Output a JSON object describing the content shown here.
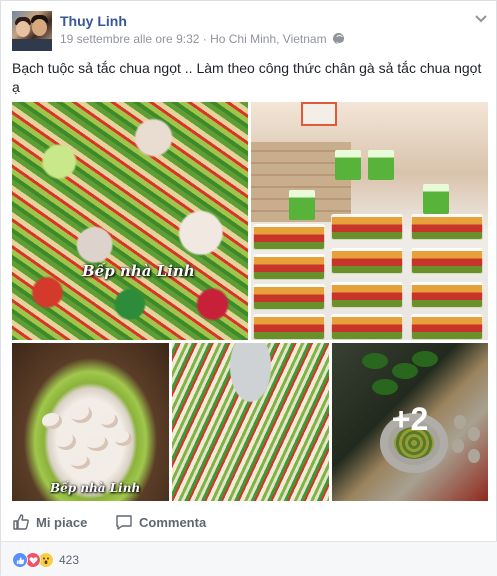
{
  "post": {
    "author": "Thuy Linh",
    "timestamp": "19 settembre alle ore 9:32",
    "location_sep": " · ",
    "location": "Ho Chi Minh, Vietnam",
    "privacy_icon": "globe-icon",
    "message": "Bạch tuộc sả tắc chua ngọt .. Làm theo công thức chân gà sả tắc chua ngọt ạ"
  },
  "photos": {
    "watermark_1": "Bếp nhà Linh",
    "watermark_3": "Bếp nhà Linh",
    "more_count": "+2"
  },
  "actions": {
    "like_label": "Mi piace",
    "comment_label": "Commenta"
  },
  "reactions": {
    "icons": [
      "like-icon",
      "love-icon",
      "wow-icon"
    ],
    "count": "423"
  },
  "colors": {
    "link": "#365899",
    "like": "#5890ff",
    "love": "#f25268",
    "wow": "#fbcd43"
  }
}
